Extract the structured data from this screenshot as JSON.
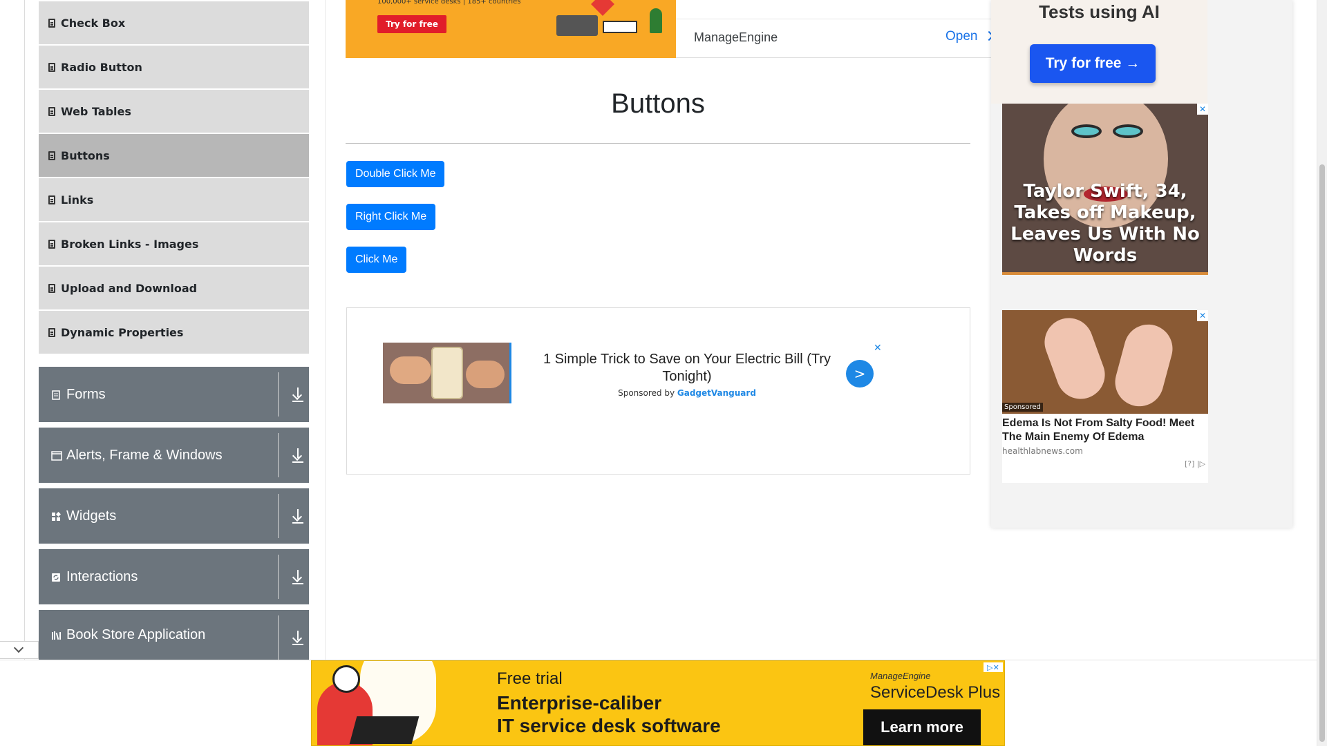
{
  "sidebar": {
    "elements_items": [
      {
        "label": "Check Box"
      },
      {
        "label": "Radio Button"
      },
      {
        "label": "Web Tables"
      },
      {
        "label": "Buttons"
      },
      {
        "label": "Links"
      },
      {
        "label": "Broken Links - Images"
      },
      {
        "label": "Upload and Download"
      },
      {
        "label": "Dynamic Properties"
      }
    ],
    "active_item": "Buttons",
    "groups": [
      {
        "label": "Forms",
        "icon": "form-icon"
      },
      {
        "label": "Alerts, Frame & Windows",
        "icon": "window-icon"
      },
      {
        "label": "Widgets",
        "icon": "widgets-icon"
      },
      {
        "label": "Interactions",
        "icon": "interactions-icon"
      },
      {
        "label": "Book Store Application",
        "icon": "book-icon"
      }
    ]
  },
  "top_ad": {
    "small_text": "100,000+ service desks | 185+ countries",
    "try_label": "Try for free",
    "brand": "ManageEngine",
    "open_label": "Open"
  },
  "main": {
    "title": "Buttons",
    "buttons": {
      "double_click": "Double Click Me",
      "right_click": "Right Click Me",
      "click": "Click Me"
    }
  },
  "native_ad": {
    "title": "1 Simple Trick to Save on Your Electric Bill (Try Tonight)",
    "sponsored_prefix": "Sponsored by",
    "sponsor": "GadgetVanguard",
    "go_label": ">",
    "close_label": "✕"
  },
  "right_ads": {
    "head_text": "Tests using AI",
    "head_button": "Try for free →",
    "taylor_headline": "Taylor Swift, 34, Takes off Makeup, Leaves Us With No Words",
    "close_label": "✕",
    "edema_badge": "Sponsored",
    "edema_title": "Edema Is Not From Salty Food! Meet The Main Enemy Of Edema",
    "edema_source": "healthlabnews.com",
    "ad_choices": "[?] |▷"
  },
  "bottom_ad": {
    "free_trial": "Free trial",
    "line1": "Enterprise-caliber",
    "line2": "IT service desk software",
    "brand": "ManageEngine",
    "product": "ServiceDesk Plus",
    "cta": "Learn more",
    "adchoices": "▷✕"
  },
  "colors": {
    "primary_button": "#007bff",
    "sidebar_item": "#dcdcdc",
    "sidebar_active": "#b7b7b7",
    "sidebar_group": "#6c757d",
    "bottom_ad_bg": "#fbc512"
  }
}
